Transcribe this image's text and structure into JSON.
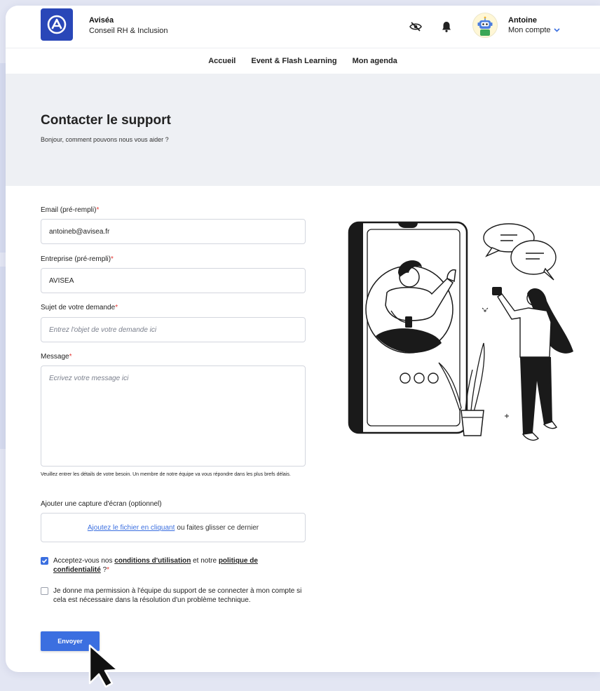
{
  "brand": {
    "name": "Aviséa",
    "subtitle": "Conseil RH & Inclusion",
    "logo_icon": "brand-logo-icon",
    "color": "#2947b8"
  },
  "header_icons": [
    "eye-off-icon",
    "bell-icon"
  ],
  "user": {
    "name": "Antoine",
    "menu_label": "Mon compte",
    "avatar_icon": "robot-avatar-icon"
  },
  "nav": {
    "items": [
      "Accueil",
      "Event & Flash Learning",
      "Mon agenda"
    ]
  },
  "hero": {
    "title": "Contacter le support",
    "subtitle": "Bonjour, comment pouvons nous vous aider ?"
  },
  "form": {
    "email": {
      "label": "Email (pré-rempli)",
      "required_mark": "*",
      "value": "antoineb@avisea.fr"
    },
    "company": {
      "label": "Entreprise (pré-rempli)",
      "required_mark": "*",
      "value": "AVISEA"
    },
    "subject": {
      "label": "Sujet de votre demande",
      "required_mark": "*",
      "placeholder": "Entrez l'objet de votre demande ici"
    },
    "message": {
      "label": "Message",
      "required_mark": "*",
      "placeholder": "Ecrivez votre message ici"
    },
    "hint": "Veuillez entrer les détails de votre besoin. Un membre de notre équipe va vous répondre dans les plus brefs délais.",
    "upload": {
      "label": "Ajouter une capture d'écran (optionnel)",
      "link_text": "Ajoutez le fichier en cliquant",
      "rest_text": "ou faites glisser ce dernier"
    },
    "consent_terms": {
      "checked": true,
      "prefix": "Acceptez-vous nos",
      "terms_link": "conditions d'utilisation",
      "middle": "et notre",
      "privacy_link": "politique de confidentialité",
      "suffix": "?",
      "required_mark": "*"
    },
    "consent_access": {
      "checked": false,
      "text": "Je donne ma permission à l'équipe du support de se connecter à mon compte si cela est nécessaire dans la résolution d'un problème technique."
    },
    "submit_label": "Envoyer"
  },
  "colors": {
    "accent": "#3b6fe0",
    "required": "#e53935",
    "hero_bg": "#eef0f4",
    "page_bg": "#e3e6f3"
  },
  "illustration_icon": "video-call-support-illustration",
  "cursor_icon": "mouse-pointer-icon"
}
